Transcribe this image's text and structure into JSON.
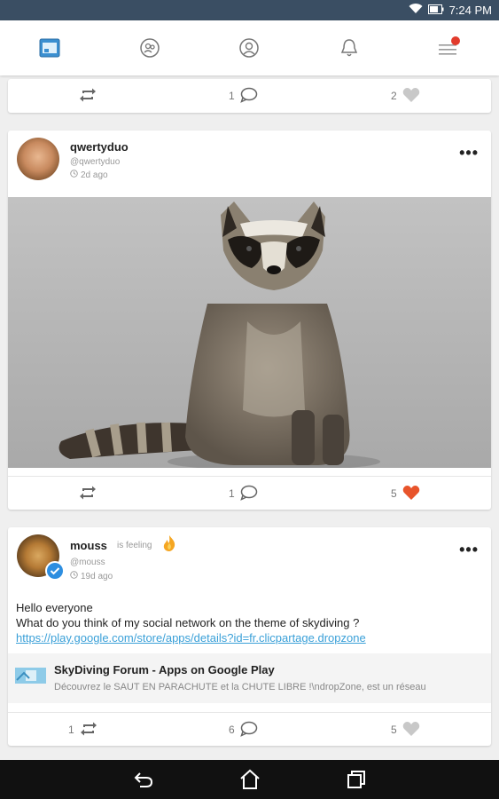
{
  "status": {
    "time": "7:24 PM"
  },
  "colors": {
    "accent": "#3aa0d8",
    "like": "#e8542b",
    "badge": "#e23b2c"
  },
  "nav": {
    "icons": [
      "feed-icon",
      "groups-icon",
      "profile-icon",
      "bell-icon",
      "menu-icon"
    ]
  },
  "posts": [
    {
      "comments": "1",
      "likes": "2"
    },
    {
      "username": "qwertyduo",
      "handle": "@qwertyduo",
      "time": "2d ago",
      "comments": "1",
      "likes": "5"
    },
    {
      "username": "mouss",
      "feeling_text": "is feeling",
      "handle": "@mouss",
      "time": "19d ago",
      "text_line1": "Hello everyone",
      "text_line2": "What do you think of my social network on the theme of skydiving ?",
      "link": "https://play.google.com/store/apps/details?id=fr.clicpartage.dropzone",
      "preview_title": "SkyDiving Forum - Apps on Google Play",
      "preview_desc": "Découvrez le SAUT EN PARACHUTE et la CHUTE LIBRE !\\ndropZone, est un réseau",
      "reposts": "1",
      "comments": "6",
      "likes": "5"
    }
  ]
}
